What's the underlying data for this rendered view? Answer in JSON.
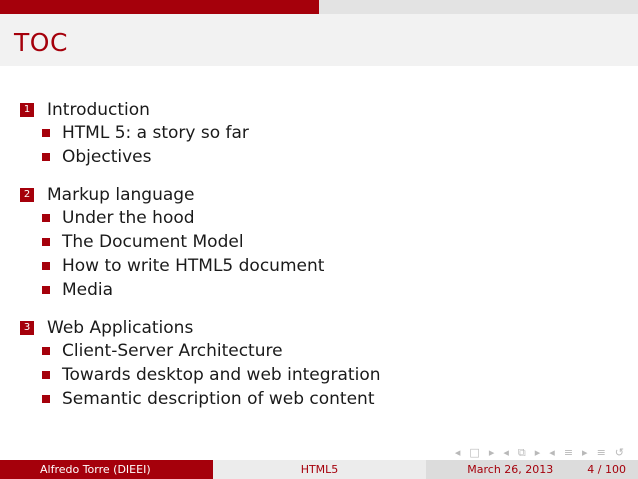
{
  "progress": {
    "fraction": 0.04
  },
  "frame": {
    "title": "TOC"
  },
  "toc": [
    {
      "number": "1",
      "label": "Introduction",
      "items": [
        "HTML 5: a story so far",
        "Objectives"
      ]
    },
    {
      "number": "2",
      "label": "Markup language",
      "items": [
        "Under the hood",
        "The Document Model",
        "How to write HTML5 document",
        "Media"
      ]
    },
    {
      "number": "3",
      "label": "Web Applications",
      "items": [
        "Client-Server Architecture",
        "Towards desktop and web integration",
        "Semantic description of web content"
      ]
    }
  ],
  "footer": {
    "author": "Alfredo Torre  (DIEEI)",
    "title": "HTML5",
    "date": "March 26, 2013",
    "page": "4 / 100"
  },
  "navigation": {
    "icons": [
      "nav-prev-frame-icon",
      "nav-frame-icon",
      "nav-next-frame-icon",
      "nav-prev-subsection-icon",
      "nav-subsection-icon",
      "nav-next-subsection-icon",
      "nav-prev-section-icon",
      "nav-section-icon",
      "nav-next-section-icon",
      "nav-menu-icon",
      "nav-loop-icon"
    ]
  },
  "colors": {
    "accent": "#a5000b",
    "title_bar": "#f2f2f2",
    "footer_mid": "#ececec",
    "footer_right": "#dcdcdc"
  }
}
